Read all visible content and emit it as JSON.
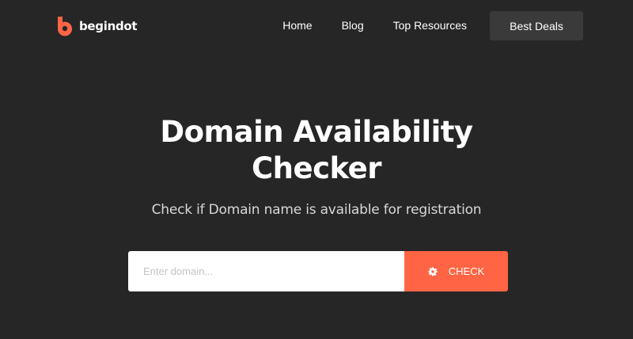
{
  "header": {
    "logo_text": "begindot",
    "nav": [
      {
        "label": "Home"
      },
      {
        "label": "Blog"
      },
      {
        "label": "Top Resources"
      }
    ],
    "deals_label": "Best Deals"
  },
  "hero": {
    "title_line1": "Domain Availability",
    "title_line2": "Checker",
    "subtitle": "Check if Domain name is available for registration"
  },
  "search": {
    "placeholder": "Enter domain...",
    "value": "",
    "button_label": "CHECK",
    "button_icon": "gear-icon"
  },
  "colors": {
    "background": "#262626",
    "accent": "#ff6544",
    "deals_button": "#3a3a3a"
  }
}
